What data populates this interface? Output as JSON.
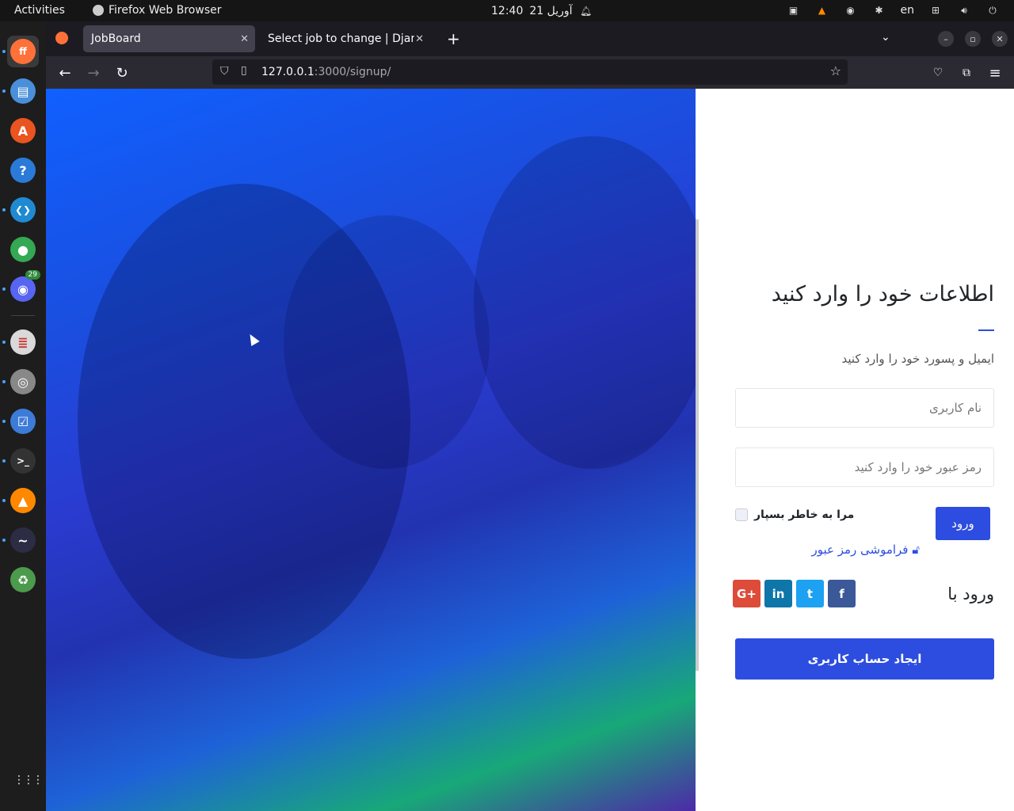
{
  "topbar": {
    "activities": "Activities",
    "app_name": "Firefox Web Browser",
    "clock_date": "آوریل 21",
    "clock_time": "12:40",
    "lang": "en"
  },
  "dock": {
    "items": [
      {
        "name": "firefox-icon",
        "glyph": "ff",
        "color": "#ff7139"
      },
      {
        "name": "files-icon",
        "glyph": "▤",
        "color": "#4a8fd9"
      },
      {
        "name": "app-center-icon",
        "glyph": "A",
        "color": "#e95420"
      },
      {
        "name": "help-icon",
        "glyph": "?",
        "color": "#2a7ad8"
      },
      {
        "name": "vscode-icon",
        "glyph": "❮❯",
        "color": "#1f8ad2"
      },
      {
        "name": "chrome-icon",
        "glyph": "●",
        "color": "#34a853"
      },
      {
        "name": "discord-icon",
        "glyph": "◉",
        "color": "#5865f2",
        "badge": "29"
      },
      {
        "name": "document-viewer-icon",
        "glyph": "≣",
        "color": "#d9d9d9"
      },
      {
        "name": "disks-icon",
        "glyph": "◎",
        "color": "#888888"
      },
      {
        "name": "todo-icon",
        "glyph": "☑",
        "color": "#3d7bd8"
      },
      {
        "name": "terminal-icon",
        "glyph": ">_",
        "color": "#333333"
      },
      {
        "name": "vlc-icon",
        "glyph": "▲",
        "color": "#ff8800"
      },
      {
        "name": "kali-icon",
        "glyph": "~",
        "color": "#2c2c44"
      },
      {
        "name": "trash-icon",
        "glyph": "♻",
        "color": "#4c9a4c"
      }
    ],
    "apps_grid": "⋮⋮⋮"
  },
  "browser": {
    "tabs": [
      {
        "label": "JobBoard",
        "active": true
      },
      {
        "label": "Select job to change | Django",
        "active": false
      }
    ],
    "url_host": "127.0.0.1",
    "url_rest": ":3000/signup/"
  },
  "form": {
    "title": "اطلاعات خود را وارد کنید",
    "subtitle": "ایمیل و پسورد خود را وارد کنید",
    "username_placeholder": "نام کاربری",
    "password_placeholder": "رمز عبور خود را وارد کنید",
    "login_label": "ورود",
    "remember_label": "مرا به خاطر بسپار",
    "forgot_label": "فراموشی رمز عبور",
    "social_label": "ورود با",
    "social": [
      {
        "name": "google-plus-button",
        "glyph": "G+",
        "color": "#dd4b39"
      },
      {
        "name": "linkedin-button",
        "glyph": "in",
        "color": "#0e76a8"
      },
      {
        "name": "twitter-button",
        "glyph": "t",
        "color": "#1da1f2"
      },
      {
        "name": "facebook-button",
        "glyph": "f",
        "color": "#3b5998"
      }
    ],
    "create_label": "ایجاد حساب کاربری"
  }
}
